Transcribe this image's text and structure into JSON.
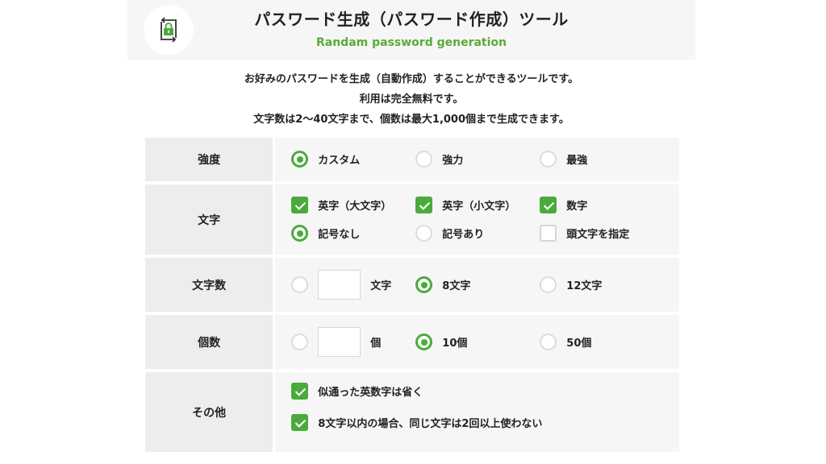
{
  "header": {
    "title": "パスワード生成（パスワード作成）ツール",
    "subtitle": "Randam password generation",
    "logo_icon": "lock-refresh-icon"
  },
  "intro": {
    "line1": "お好みのパスワードを生成（自動作成）することができるツールです。",
    "line2": "利用は完全無料です。",
    "line3": "文字数は2〜40文字まで、個数は最大1,000個まで生成できます。"
  },
  "colors": {
    "accent": "#4aab3c",
    "label_bg": "#ededed",
    "body_bg": "#f6f6f6"
  },
  "strength": {
    "label": "強度",
    "options": [
      {
        "label": "カスタム",
        "selected": true
      },
      {
        "label": "強力",
        "selected": false
      },
      {
        "label": "最強",
        "selected": false
      }
    ]
  },
  "chars": {
    "label": "文字",
    "uppercase": {
      "label": "英字（大文字）",
      "checked": true
    },
    "lowercase": {
      "label": "英字（小文字）",
      "checked": true
    },
    "digits": {
      "label": "数字",
      "checked": true
    },
    "no_symbols": {
      "label": "記号なし",
      "selected": true
    },
    "with_symbols": {
      "label": "記号あり",
      "selected": false
    },
    "first_char": {
      "label": "頭文字を指定",
      "checked": false
    }
  },
  "length": {
    "label": "文字数",
    "custom_unit": "文字",
    "custom_value": "",
    "options": [
      {
        "label": "8文字",
        "selected": true
      },
      {
        "label": "12文字",
        "selected": false
      }
    ]
  },
  "count": {
    "label": "個数",
    "custom_unit": "個",
    "custom_value": "",
    "options": [
      {
        "label": "10個",
        "selected": true
      },
      {
        "label": "50個",
        "selected": false
      }
    ]
  },
  "other": {
    "label": "その他",
    "similar": {
      "label": "似通った英数字は省く",
      "checked": true
    },
    "no_repeat": {
      "label": "8文字以内の場合、同じ文字は2回以上使わない",
      "checked": true
    }
  }
}
